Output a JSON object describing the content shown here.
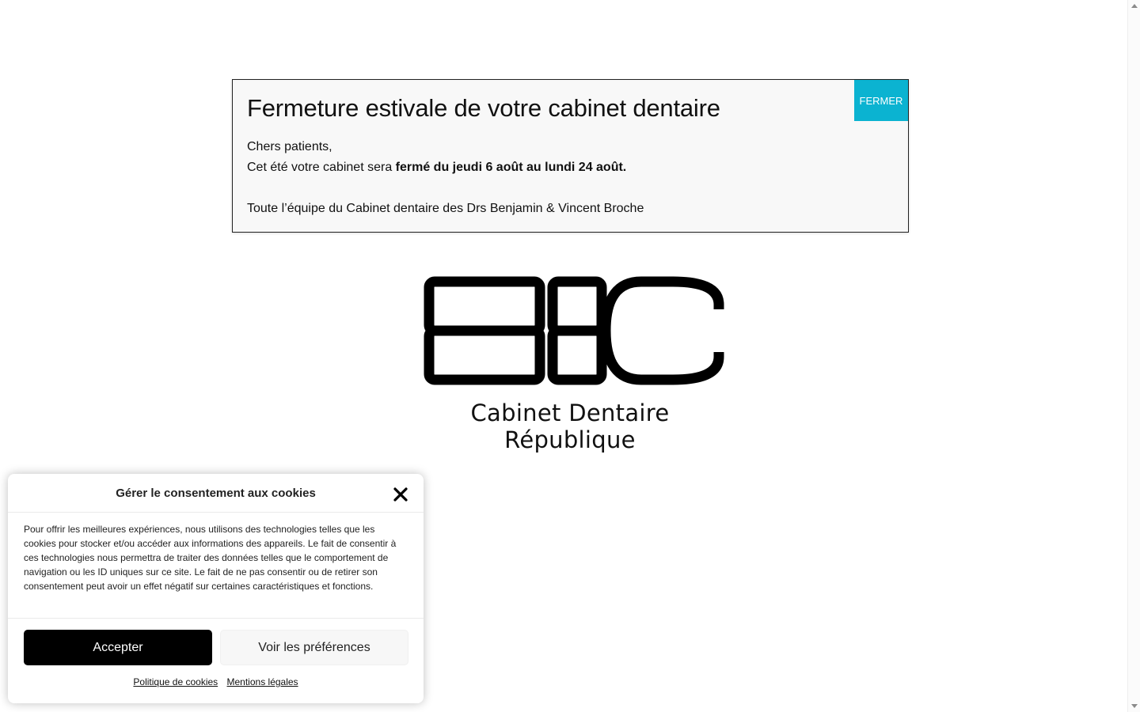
{
  "notice": {
    "title": "Fermeture estivale de votre cabinet dentaire",
    "close_label": "FERMER",
    "greeting": "Chers patients,",
    "line2_prefix": "Cet été votre cabinet sera ",
    "line2_bold": "fermé du jeudi 6 août au lundi 24 août.",
    "signature": "Toute l’équipe du Cabinet dentaire des Drs Benjamin & Vincent Broche"
  },
  "logo": {
    "monogram": "BBC",
    "name": "Cabinet Dentaire République"
  },
  "cookie": {
    "title": "Gérer le consentement aux cookies",
    "text": "Pour offrir les meilleures expériences, nous utilisons des technologies telles que les cookies pour stocker et/ou accéder aux informations des appareils. Le fait de consentir à ces technologies nous permettra de traiter des données telles que le comportement de navigation ou les ID uniques sur ce site. Le fait de ne pas consentir ou de retirer son consentement peut avoir un effet négatif sur certaines caractéristiques et fonctions.",
    "accept_label": "Accepter",
    "prefs_label": "Voir les préférences",
    "links": [
      "Politique de cookies",
      "Mentions légales"
    ]
  },
  "colors": {
    "close_button": "#0bb3d1",
    "accept_button": "#000000"
  }
}
